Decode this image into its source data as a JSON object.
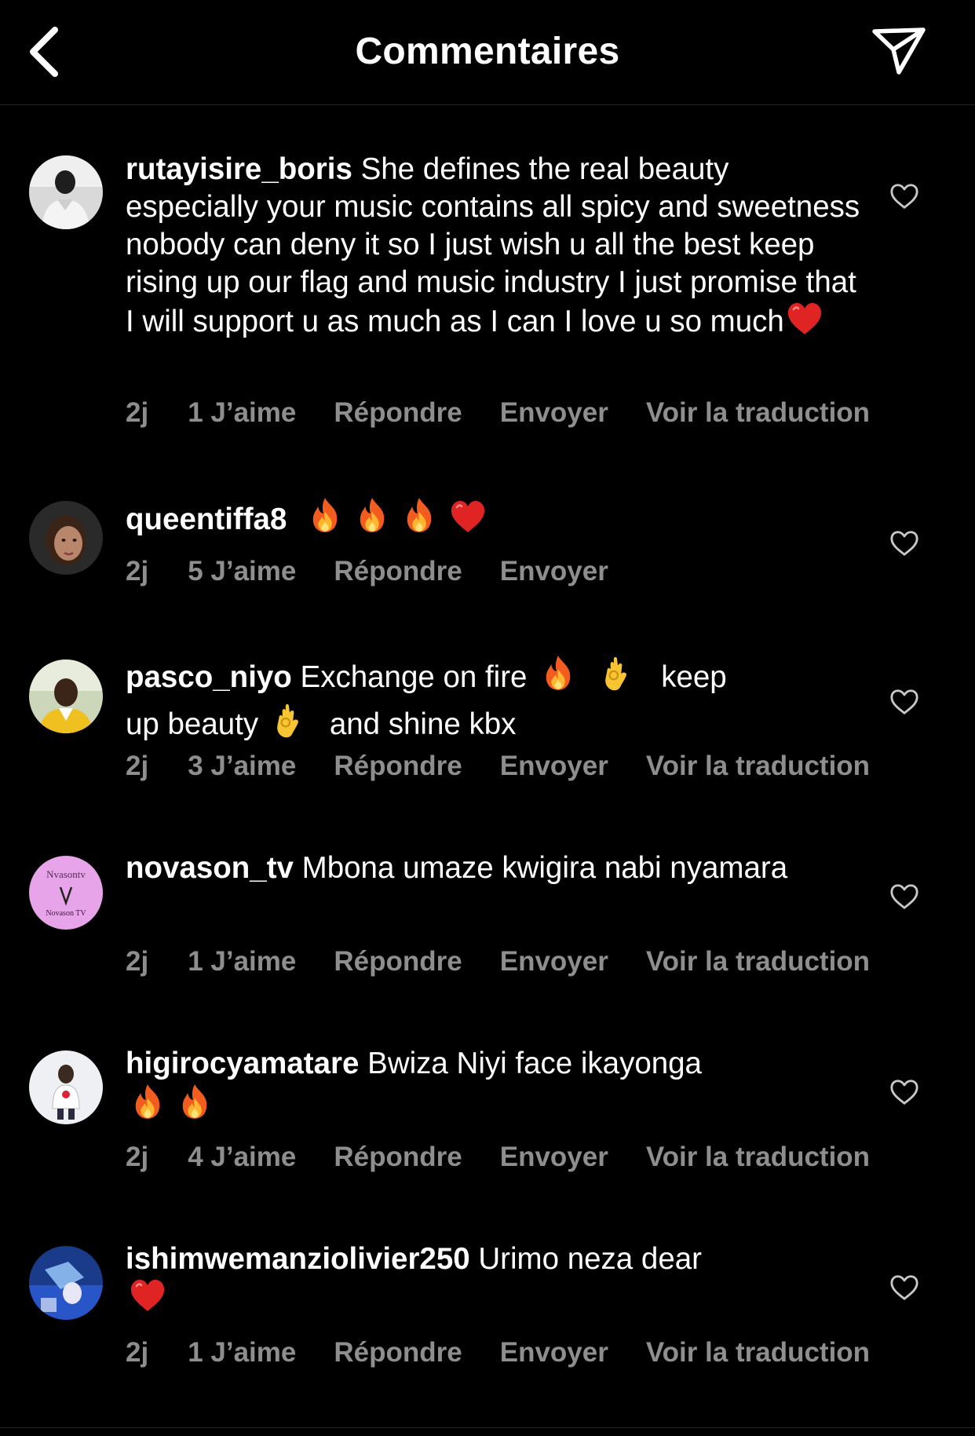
{
  "header": {
    "title": "Commentaires"
  },
  "colors": {
    "background": "#000000",
    "text": "#ffffff",
    "muted": "#8e8e8e"
  },
  "comments": [
    {
      "username": "rutayisire_boris",
      "text": "She defines the real beauty especially your music contains all spicy and sweetness nobody can deny it so I just wish u all the best keep rising up our flag and music industry I just promise that I will support u as much as I can I love u so much",
      "emoji": "heart-emoji",
      "time": "2j",
      "likes": "1 J’aime",
      "reply": "Répondre",
      "send": "Envoyer",
      "translate": "Voir la traduction",
      "avatar": "avatar-person-light"
    },
    {
      "username": "queentiffa8",
      "text": "",
      "emoji": "fire-fire-fire-heart",
      "time": "2j",
      "likes": "5 J’aime",
      "reply": "Répondre",
      "send": "Envoyer",
      "avatar": "avatar-woman"
    },
    {
      "username": "pasco_niyo",
      "text_parts": [
        "Exchange  on fire",
        "keep",
        "up beauty",
        "and shine kbx"
      ],
      "time": "2j",
      "likes": "3 J’aime",
      "reply": "Répondre",
      "send": "Envoyer",
      "translate": "Voir la traduction",
      "avatar": "avatar-man-outdoor"
    },
    {
      "username": "novason_tv",
      "text": "Mbona umaze kwigira nabi nyamara",
      "time": "2j",
      "likes": "1 J’aime",
      "reply": "Répondre",
      "send": "Envoyer",
      "translate": "Voir la traduction",
      "avatar": "avatar-novason-logo",
      "avatar_text_top": "Nvasontv",
      "avatar_text_bottom": "Novason TV"
    },
    {
      "username": "higirocyamatare",
      "text": "Bwiza Niyi face ikayonga",
      "emoji": "fire-fire",
      "time": "2j",
      "likes": "4 J’aime",
      "reply": "Répondre",
      "send": "Envoyer",
      "translate": "Voir la traduction",
      "avatar": "avatar-man-white"
    },
    {
      "username": "ishimwemanziolivier250",
      "text": "Urimo neza dear",
      "emoji": "heart",
      "time": "2j",
      "likes": "1 J’aime",
      "reply": "Répondre",
      "send": "Envoyer",
      "translate": "Voir la traduction",
      "avatar": "avatar-blue-scene"
    }
  ]
}
